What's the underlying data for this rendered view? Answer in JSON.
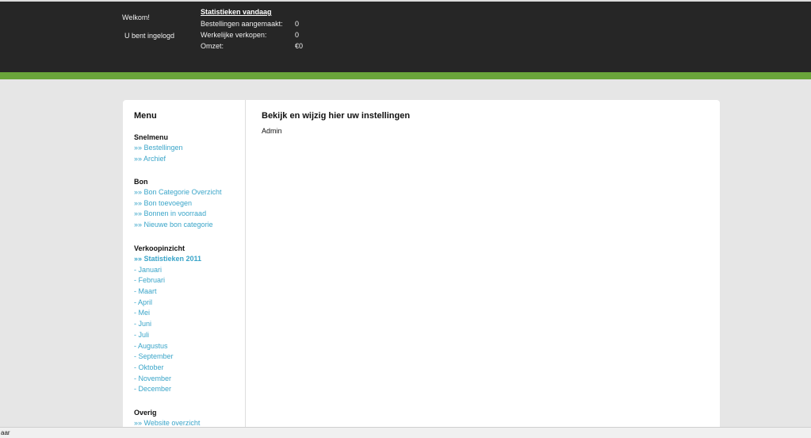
{
  "header": {
    "welcome": "Welkom!",
    "logged_in": "U bent ingelogd",
    "stats_title": "Statistieken vandaag",
    "stats": [
      {
        "label": "Bestellingen aangemaakt:",
        "value": "0"
      },
      {
        "label": "Werkelijke verkopen:",
        "value": "0"
      },
      {
        "label": "Omzet:",
        "value": "€0"
      }
    ]
  },
  "colors": {
    "header_bg": "#262626",
    "accent_green": "#6aa53a",
    "link": "#3aa5c9"
  },
  "sidebar": {
    "title": "Menu",
    "sections": [
      {
        "heading": "Snelmenu",
        "items": [
          "»» Bestellingen",
          "»» Archief"
        ]
      },
      {
        "heading": "Bon",
        "items": [
          "»» Bon Categorie Overzicht",
          "»» Bon toevoegen",
          "»» Bonnen in voorraad",
          "»» Nieuwe bon categorie"
        ]
      },
      {
        "heading": "Verkoopinzicht",
        "items": [
          "»» Statistieken 2011",
          "- Januari",
          "- Februari",
          "- Maart",
          "- April",
          "- Mei",
          "- Juni",
          "- Juli",
          "- Augustus",
          "- September",
          "- Oktober",
          "- November",
          "- December"
        ]
      },
      {
        "heading": "Overig",
        "items": [
          "»» Website overzicht"
        ]
      }
    ]
  },
  "main": {
    "title": "Bekijk en wijzig hier uw instellingen",
    "text": "Admin"
  },
  "statusbar": {
    "text": "aar"
  }
}
